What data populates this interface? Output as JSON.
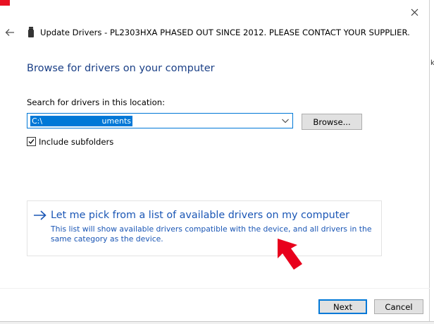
{
  "window": {
    "title": "Update Drivers - PL2303HXA PHASED OUT SINCE 2012. PLEASE CONTACT YOUR SUPPLIER.",
    "close_icon": "close-icon",
    "back_icon": "back-arrow-icon",
    "device_icon": "usb-device-icon"
  },
  "main": {
    "heading": "Browse for drivers on your computer",
    "search_label": "Search for drivers in this location:",
    "path_field": {
      "value_start": "C:\\",
      "value_end": "uments"
    },
    "browse_label": "Browse...",
    "include_subfolders": {
      "label": "Include subfolders",
      "checked": true,
      "check_glyph": "✓"
    },
    "pick_option": {
      "title": "Let me pick from a list of available drivers on my computer",
      "description": "This list will show available drivers compatible with the device, and all drivers in the same category as the device."
    }
  },
  "footer": {
    "next_label": "Next",
    "cancel_label": "Cancel"
  },
  "colors": {
    "accent": "#0078d7",
    "heading": "#1a3f86",
    "link": "#1a56b5",
    "annotation_arrow": "#e8001c"
  },
  "background_window": {
    "fragment_text": "k"
  }
}
